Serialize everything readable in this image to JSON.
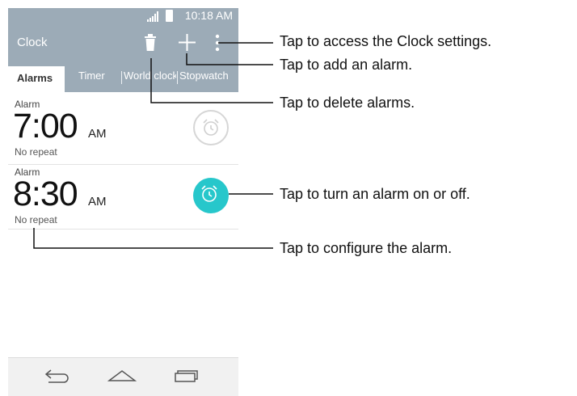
{
  "status_bar": {
    "time": "10:18 AM"
  },
  "action_bar": {
    "title": "Clock"
  },
  "tabs": [
    {
      "label": "Alarms"
    },
    {
      "label": "Timer"
    },
    {
      "label": "World clock"
    },
    {
      "label": "Stopwatch"
    }
  ],
  "alarms": [
    {
      "label": "Alarm",
      "time": "7:00",
      "ampm": "AM",
      "repeat": "No repeat",
      "enabled": false
    },
    {
      "label": "Alarm",
      "time": "8:30",
      "ampm": "AM",
      "repeat": "No repeat",
      "enabled": true
    }
  ],
  "callouts": {
    "settings": "Tap to access the Clock settings.",
    "add": "Tap to add an alarm.",
    "delete": "Tap to delete alarms.",
    "toggle": "Tap to turn an alarm on or off.",
    "configure": "Tap to configure the alarm."
  },
  "colors": {
    "bar": "#9cabb7",
    "accent_on": "#27c7cb",
    "toggle_off": "#d6d6d6"
  },
  "icons": [
    "signal-icon",
    "battery-icon",
    "trash-icon",
    "add-icon",
    "overflow-menu-icon",
    "alarm-clock-icon",
    "back-icon",
    "home-icon",
    "recent-apps-icon"
  ]
}
